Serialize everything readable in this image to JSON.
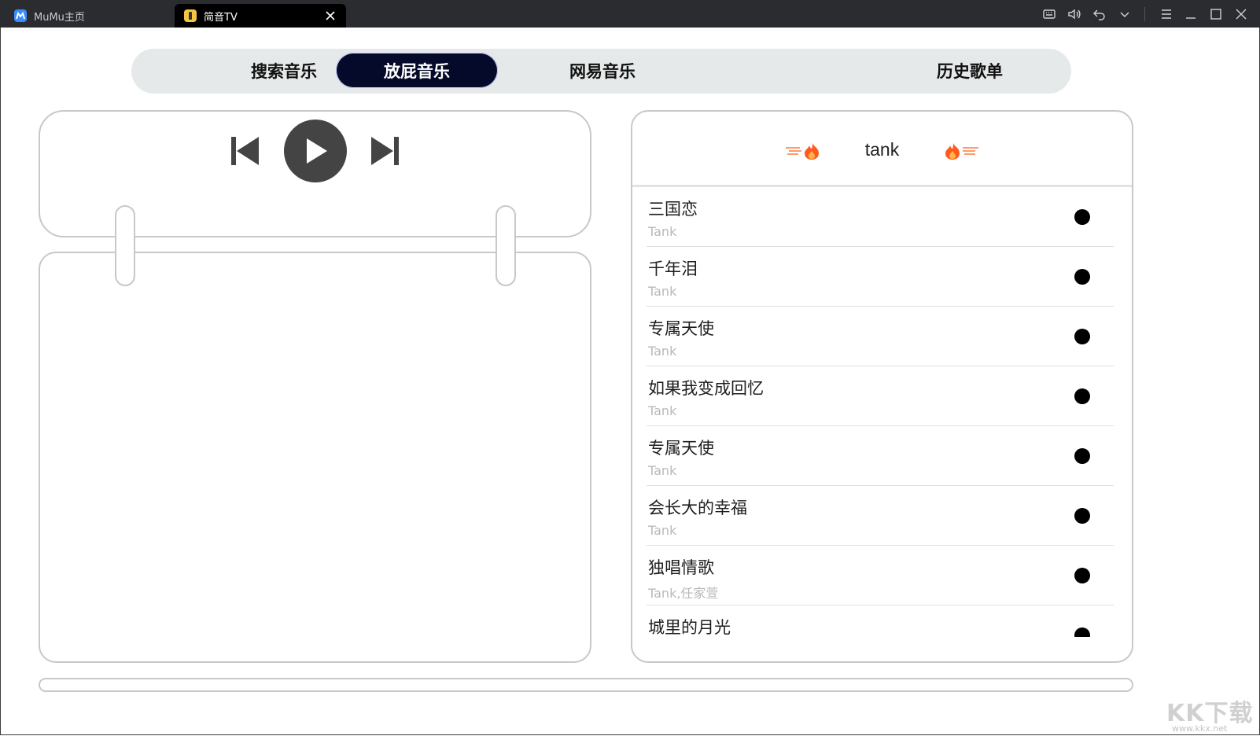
{
  "window": {
    "tabs": [
      {
        "label": "MuMu主页"
      },
      {
        "label": "简音TV"
      }
    ]
  },
  "nav": {
    "items": [
      {
        "label": "搜索音乐"
      },
      {
        "label": "放屁音乐",
        "active": true
      },
      {
        "label": "网易音乐"
      },
      {
        "label": "历史歌单"
      }
    ]
  },
  "player": {
    "controls": [
      "previous-icon",
      "play-icon",
      "next-icon"
    ],
    "progress_fraction": 0
  },
  "playlist": {
    "artist": "tank",
    "songs": [
      {
        "title": "三国恋",
        "artist": "Tank"
      },
      {
        "title": "千年泪",
        "artist": "Tank"
      },
      {
        "title": "专属天使",
        "artist": "Tank"
      },
      {
        "title": "如果我变成回忆",
        "artist": "Tank"
      },
      {
        "title": "专属天使",
        "artist": "Tank"
      },
      {
        "title": "会长大的幸福",
        "artist": "Tank"
      },
      {
        "title": "独唱情歌",
        "artist": "Tank,任家萱"
      },
      {
        "title": "城里的月光",
        "artist": ""
      }
    ]
  },
  "watermark": {
    "logo": "KK下载",
    "url": "www.kkx.net"
  },
  "colors": {
    "titlebar": "#2b2c30",
    "nav_bg": "#e6e9ea",
    "nav_active": "#050a2a",
    "control": "#444444",
    "fire": "#ff5a1f"
  }
}
